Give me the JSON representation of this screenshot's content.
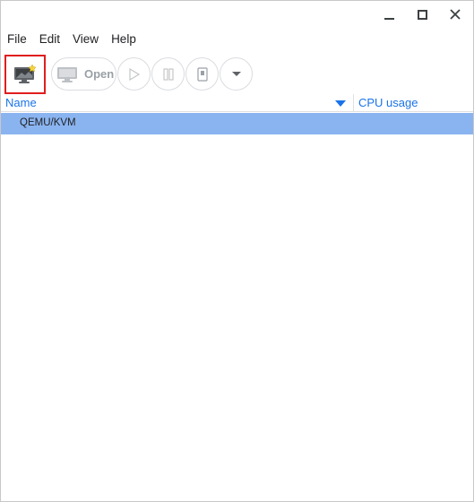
{
  "menubar": {
    "items": [
      "File",
      "Edit",
      "View",
      "Help"
    ]
  },
  "toolbar": {
    "new_icon": "new-vm-monitor-icon",
    "open_label": "Open",
    "run_icon": "play-icon",
    "pause_icon": "pause-icon",
    "shutdown_icon": "shutdown-icon",
    "menu_icon": "chevron-down-icon"
  },
  "table": {
    "columns": [
      "Name",
      "CPU usage"
    ],
    "sort_column": "Name",
    "rows": [
      {
        "name": "QEMU/KVM",
        "selected": true
      }
    ]
  },
  "colors": {
    "accent": "#1a73e8",
    "selection": "#8ab4f0",
    "highlight_border": "#e01e1e"
  }
}
